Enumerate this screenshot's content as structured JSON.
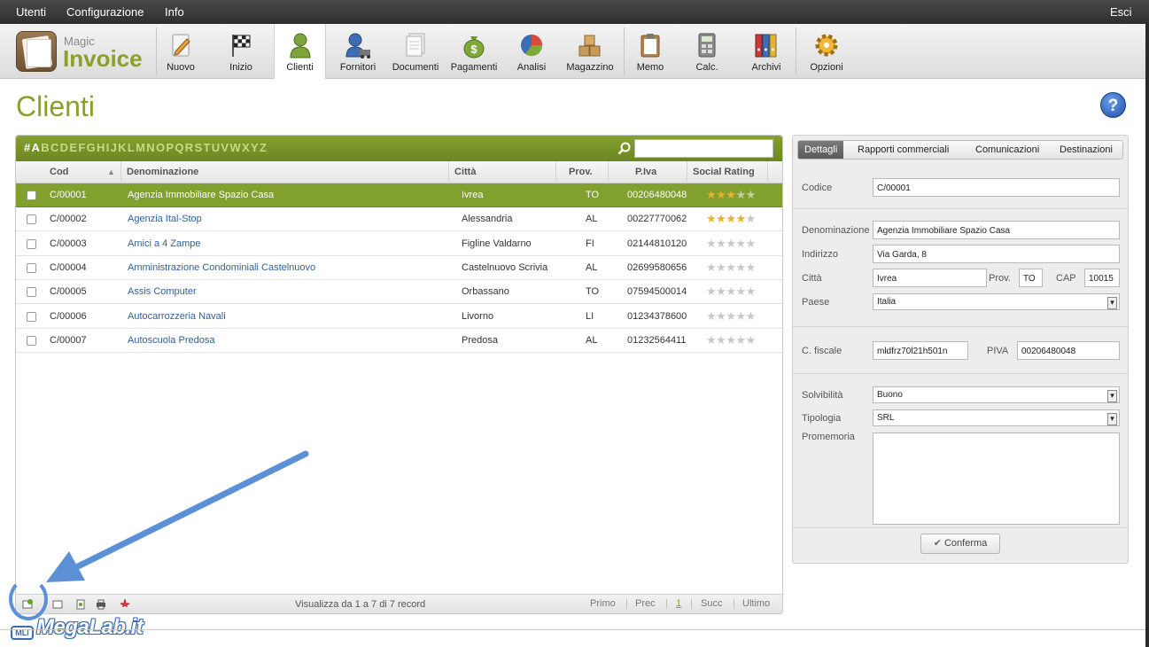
{
  "menubar": {
    "items": [
      "Utenti",
      "Configurazione",
      "Info"
    ],
    "exit": "Esci"
  },
  "logo": {
    "line1": "Magic",
    "line2": "Invoice"
  },
  "toolbar": [
    {
      "label": "Nuovo",
      "icon": "pencil-icon"
    },
    {
      "label": "Inizio",
      "icon": "checkered-flag-icon"
    },
    {
      "label": "Clienti",
      "icon": "user-icon"
    },
    {
      "label": "Fornitori",
      "icon": "supplier-icon"
    },
    {
      "label": "Documenti",
      "icon": "documents-icon"
    },
    {
      "label": "Pagamenti",
      "icon": "money-bag-icon"
    },
    {
      "label": "Analisi",
      "icon": "pie-chart-icon"
    },
    {
      "label": "Magazzino",
      "icon": "boxes-icon"
    },
    {
      "label": "Memo",
      "icon": "clipboard-icon"
    },
    {
      "label": "Calc.",
      "icon": "calculator-icon"
    },
    {
      "label": "Archivi",
      "icon": "binders-icon"
    },
    {
      "label": "Opzioni",
      "icon": "gear-icon"
    }
  ],
  "page_title": "Clienti",
  "help_label": "?",
  "alphabet": [
    "#",
    "A",
    "B",
    "C",
    "D",
    "E",
    "F",
    "G",
    "H",
    "I",
    "J",
    "K",
    "L",
    "M",
    "N",
    "O",
    "P",
    "Q",
    "R",
    "S",
    "T",
    "U",
    "V",
    "W",
    "X",
    "Y",
    "Z"
  ],
  "alphabet_selected": "A",
  "columns": [
    "Cod",
    "Denominazione",
    "Città",
    "Prov.",
    "P.Iva",
    "Social Rating"
  ],
  "sort_indicator": "▲",
  "rows": [
    {
      "cod": "C/00001",
      "name": "Agenzia Immobiliare Spazio Casa",
      "city": "Ivrea",
      "prov": "TO",
      "piva": "00206480048",
      "rating": 3,
      "selected": true
    },
    {
      "cod": "C/00002",
      "name": "Agenzia Ital-Stop",
      "city": "Alessandria",
      "prov": "AL",
      "piva": "00227770062",
      "rating": 4,
      "selected": false
    },
    {
      "cod": "C/00003",
      "name": "Amici a 4 Zampe",
      "city": "Figline Valdarno",
      "prov": "FI",
      "piva": "02144810120",
      "rating": 0,
      "selected": false
    },
    {
      "cod": "C/00004",
      "name": "Amministrazione Condominiali Castelnuovo",
      "city": "Castelnuovo Scrivia",
      "prov": "AL",
      "piva": "02699580656",
      "rating": 0,
      "selected": false
    },
    {
      "cod": "C/00005",
      "name": "Assis Computer",
      "city": "Orbassano",
      "prov": "TO",
      "piva": "07594500014",
      "rating": 0,
      "selected": false
    },
    {
      "cod": "C/00006",
      "name": "Autocarrozzeria Navali",
      "city": "Livorno",
      "prov": "LI",
      "piva": "01234378600",
      "rating": 0,
      "selected": false
    },
    {
      "cod": "C/00007",
      "name": "Autoscuola Predosa",
      "city": "Predosa",
      "prov": "AL",
      "piva": "01232564411",
      "rating": 0,
      "selected": false
    }
  ],
  "footer": {
    "info": "Visualizza da 1 a 7 di 7 record",
    "first": "Primo",
    "prev": "Prec",
    "page": "1",
    "next": "Succ",
    "last": "Ultimo"
  },
  "detail": {
    "tabs": [
      "Dettagli",
      "Rapporti commerciali",
      "Comunicazioni",
      "Destinazioni"
    ],
    "labels": {
      "codice": "Codice",
      "denominazione": "Denominazione",
      "indirizzo": "Indirizzo",
      "citta": "Città",
      "prov": "Prov.",
      "cap": "CAP",
      "paese": "Paese",
      "cf": "C. fiscale",
      "piva": "PIVA",
      "solvibilita": "Solvibilità",
      "tipologia": "Tipologia",
      "promemoria": "Promemoria"
    },
    "values": {
      "codice": "C/00001",
      "denominazione": "Agenzia Immobiliare Spazio Casa",
      "indirizzo": "Via Garda, 8",
      "citta": "Ivrea",
      "prov": "TO",
      "cap": "10015",
      "paese": "Italia",
      "cf": "mldfrz70l21h501n",
      "piva": "00206480048",
      "solvibilita": "Buono",
      "tipologia": "SRL",
      "promemoria": ""
    },
    "confirm": "Conferma"
  },
  "watermark": {
    "text": "MegaLab.it",
    "badge": "MLI"
  },
  "colors": {
    "accent": "#81a02d",
    "link": "#2f5f9e",
    "arrow": "#5b8fd6"
  }
}
